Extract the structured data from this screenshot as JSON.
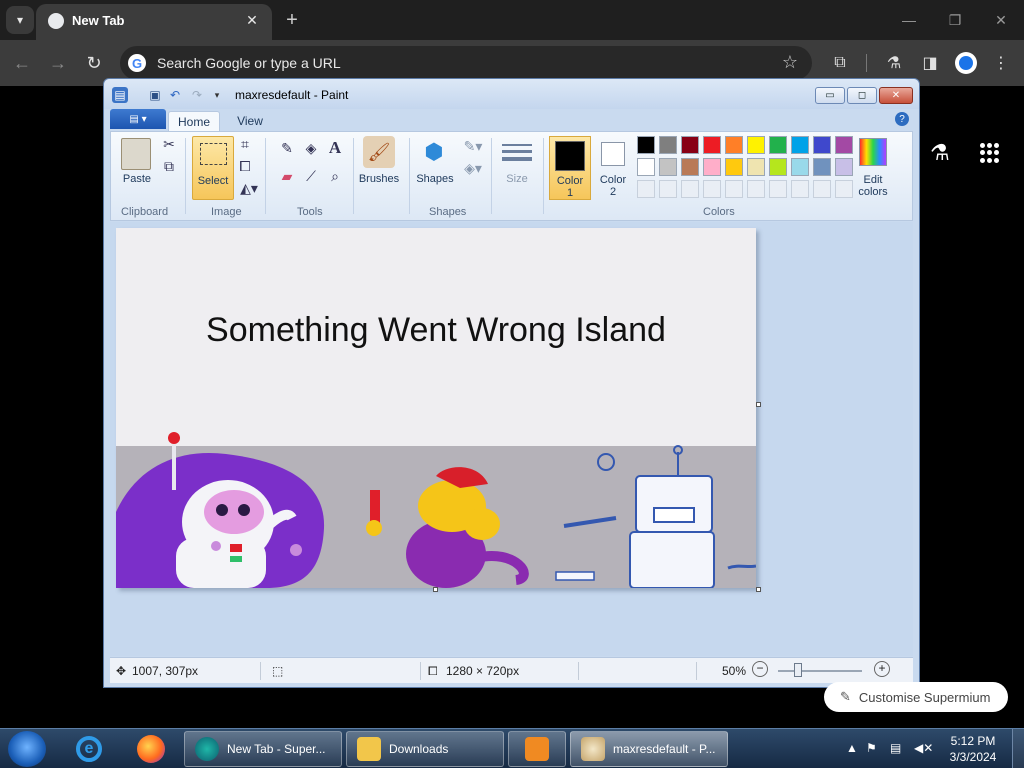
{
  "browser": {
    "tab_title": "New Tab",
    "omnibox_placeholder": "Search Google or type a URL",
    "customise_label": "Customise Supermium"
  },
  "paint": {
    "window_title": "maxresdefault - Paint",
    "tabs": [
      "Home",
      "View"
    ],
    "ribbon": {
      "paste": "Paste",
      "select": "Select",
      "brushes": "Brushes",
      "shapes": "Shapes",
      "size": "Size",
      "color1": "Color 1",
      "color1_line1": "Color",
      "color1_line2": "1",
      "color2_line1": "Color",
      "color2_line2": "2",
      "edit_colors_line1": "Edit",
      "edit_colors_line2": "colors",
      "groups": {
        "clipboard": "Clipboard",
        "image": "Image",
        "tools": "Tools",
        "shapes": "Shapes",
        "colors": "Colors"
      }
    },
    "palette_row1": [
      "#000000",
      "#7f7f7f",
      "#880015",
      "#ed1c24",
      "#ff7f27",
      "#fff200",
      "#22b14c",
      "#00a2e8",
      "#3f48cc",
      "#a349a4"
    ],
    "palette_row2": [
      "#ffffff",
      "#c3c3c3",
      "#b97a57",
      "#ffaec9",
      "#ffc90e",
      "#efe4b0",
      "#b5e61d",
      "#99d9ea",
      "#7092be",
      "#c8bfe7"
    ],
    "canvas_text": "Something Went Wrong Island",
    "status": {
      "cursor_pos": "1007, 307px",
      "image_size": "1280 × 720px",
      "zoom": "50%"
    }
  },
  "taskbar": {
    "tasks": [
      "New Tab - Super...",
      "Downloads",
      "maxresdefault - P..."
    ],
    "time": "5:12 PM",
    "date": "3/3/2024"
  }
}
